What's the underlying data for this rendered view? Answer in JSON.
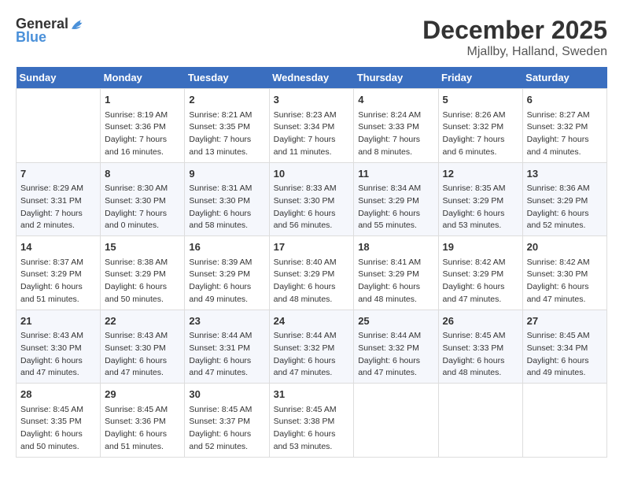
{
  "logo": {
    "general": "General",
    "blue": "Blue"
  },
  "title": "December 2025",
  "subtitle": "Mjallby, Halland, Sweden",
  "days_of_week": [
    "Sunday",
    "Monday",
    "Tuesday",
    "Wednesday",
    "Thursday",
    "Friday",
    "Saturday"
  ],
  "weeks": [
    [
      {
        "num": "",
        "sunrise": "",
        "sunset": "",
        "daylight": ""
      },
      {
        "num": "1",
        "sunrise": "Sunrise: 8:19 AM",
        "sunset": "Sunset: 3:36 PM",
        "daylight": "Daylight: 7 hours and 16 minutes."
      },
      {
        "num": "2",
        "sunrise": "Sunrise: 8:21 AM",
        "sunset": "Sunset: 3:35 PM",
        "daylight": "Daylight: 7 hours and 13 minutes."
      },
      {
        "num": "3",
        "sunrise": "Sunrise: 8:23 AM",
        "sunset": "Sunset: 3:34 PM",
        "daylight": "Daylight: 7 hours and 11 minutes."
      },
      {
        "num": "4",
        "sunrise": "Sunrise: 8:24 AM",
        "sunset": "Sunset: 3:33 PM",
        "daylight": "Daylight: 7 hours and 8 minutes."
      },
      {
        "num": "5",
        "sunrise": "Sunrise: 8:26 AM",
        "sunset": "Sunset: 3:32 PM",
        "daylight": "Daylight: 7 hours and 6 minutes."
      },
      {
        "num": "6",
        "sunrise": "Sunrise: 8:27 AM",
        "sunset": "Sunset: 3:32 PM",
        "daylight": "Daylight: 7 hours and 4 minutes."
      }
    ],
    [
      {
        "num": "7",
        "sunrise": "Sunrise: 8:29 AM",
        "sunset": "Sunset: 3:31 PM",
        "daylight": "Daylight: 7 hours and 2 minutes."
      },
      {
        "num": "8",
        "sunrise": "Sunrise: 8:30 AM",
        "sunset": "Sunset: 3:30 PM",
        "daylight": "Daylight: 7 hours and 0 minutes."
      },
      {
        "num": "9",
        "sunrise": "Sunrise: 8:31 AM",
        "sunset": "Sunset: 3:30 PM",
        "daylight": "Daylight: 6 hours and 58 minutes."
      },
      {
        "num": "10",
        "sunrise": "Sunrise: 8:33 AM",
        "sunset": "Sunset: 3:30 PM",
        "daylight": "Daylight: 6 hours and 56 minutes."
      },
      {
        "num": "11",
        "sunrise": "Sunrise: 8:34 AM",
        "sunset": "Sunset: 3:29 PM",
        "daylight": "Daylight: 6 hours and 55 minutes."
      },
      {
        "num": "12",
        "sunrise": "Sunrise: 8:35 AM",
        "sunset": "Sunset: 3:29 PM",
        "daylight": "Daylight: 6 hours and 53 minutes."
      },
      {
        "num": "13",
        "sunrise": "Sunrise: 8:36 AM",
        "sunset": "Sunset: 3:29 PM",
        "daylight": "Daylight: 6 hours and 52 minutes."
      }
    ],
    [
      {
        "num": "14",
        "sunrise": "Sunrise: 8:37 AM",
        "sunset": "Sunset: 3:29 PM",
        "daylight": "Daylight: 6 hours and 51 minutes."
      },
      {
        "num": "15",
        "sunrise": "Sunrise: 8:38 AM",
        "sunset": "Sunset: 3:29 PM",
        "daylight": "Daylight: 6 hours and 50 minutes."
      },
      {
        "num": "16",
        "sunrise": "Sunrise: 8:39 AM",
        "sunset": "Sunset: 3:29 PM",
        "daylight": "Daylight: 6 hours and 49 minutes."
      },
      {
        "num": "17",
        "sunrise": "Sunrise: 8:40 AM",
        "sunset": "Sunset: 3:29 PM",
        "daylight": "Daylight: 6 hours and 48 minutes."
      },
      {
        "num": "18",
        "sunrise": "Sunrise: 8:41 AM",
        "sunset": "Sunset: 3:29 PM",
        "daylight": "Daylight: 6 hours and 48 minutes."
      },
      {
        "num": "19",
        "sunrise": "Sunrise: 8:42 AM",
        "sunset": "Sunset: 3:29 PM",
        "daylight": "Daylight: 6 hours and 47 minutes."
      },
      {
        "num": "20",
        "sunrise": "Sunrise: 8:42 AM",
        "sunset": "Sunset: 3:30 PM",
        "daylight": "Daylight: 6 hours and 47 minutes."
      }
    ],
    [
      {
        "num": "21",
        "sunrise": "Sunrise: 8:43 AM",
        "sunset": "Sunset: 3:30 PM",
        "daylight": "Daylight: 6 hours and 47 minutes."
      },
      {
        "num": "22",
        "sunrise": "Sunrise: 8:43 AM",
        "sunset": "Sunset: 3:30 PM",
        "daylight": "Daylight: 6 hours and 47 minutes."
      },
      {
        "num": "23",
        "sunrise": "Sunrise: 8:44 AM",
        "sunset": "Sunset: 3:31 PM",
        "daylight": "Daylight: 6 hours and 47 minutes."
      },
      {
        "num": "24",
        "sunrise": "Sunrise: 8:44 AM",
        "sunset": "Sunset: 3:32 PM",
        "daylight": "Daylight: 6 hours and 47 minutes."
      },
      {
        "num": "25",
        "sunrise": "Sunrise: 8:44 AM",
        "sunset": "Sunset: 3:32 PM",
        "daylight": "Daylight: 6 hours and 47 minutes."
      },
      {
        "num": "26",
        "sunrise": "Sunrise: 8:45 AM",
        "sunset": "Sunset: 3:33 PM",
        "daylight": "Daylight: 6 hours and 48 minutes."
      },
      {
        "num": "27",
        "sunrise": "Sunrise: 8:45 AM",
        "sunset": "Sunset: 3:34 PM",
        "daylight": "Daylight: 6 hours and 49 minutes."
      }
    ],
    [
      {
        "num": "28",
        "sunrise": "Sunrise: 8:45 AM",
        "sunset": "Sunset: 3:35 PM",
        "daylight": "Daylight: 6 hours and 50 minutes."
      },
      {
        "num": "29",
        "sunrise": "Sunrise: 8:45 AM",
        "sunset": "Sunset: 3:36 PM",
        "daylight": "Daylight: 6 hours and 51 minutes."
      },
      {
        "num": "30",
        "sunrise": "Sunrise: 8:45 AM",
        "sunset": "Sunset: 3:37 PM",
        "daylight": "Daylight: 6 hours and 52 minutes."
      },
      {
        "num": "31",
        "sunrise": "Sunrise: 8:45 AM",
        "sunset": "Sunset: 3:38 PM",
        "daylight": "Daylight: 6 hours and 53 minutes."
      },
      {
        "num": "",
        "sunrise": "",
        "sunset": "",
        "daylight": ""
      },
      {
        "num": "",
        "sunrise": "",
        "sunset": "",
        "daylight": ""
      },
      {
        "num": "",
        "sunrise": "",
        "sunset": "",
        "daylight": ""
      }
    ]
  ]
}
